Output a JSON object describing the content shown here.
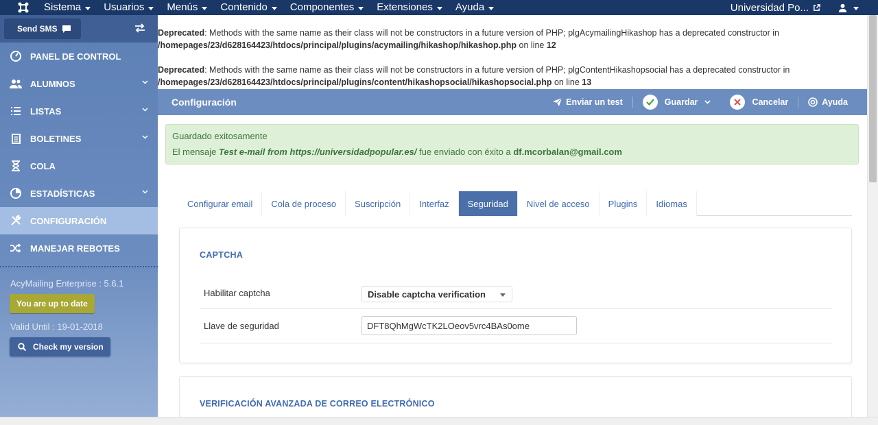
{
  "topbar": {
    "menu": [
      "Sistema",
      "Usuarios",
      "Menús",
      "Contenido",
      "Componentes",
      "Extensiones",
      "Ayuda"
    ],
    "site_name": "Universidad Po..."
  },
  "sidebar": {
    "sms_label": "Send SMS",
    "items": [
      {
        "label": "PANEL DE CONTROL",
        "icon": "dashboard-icon"
      },
      {
        "label": "ALUMNOS",
        "icon": "users-icon"
      },
      {
        "label": "LISTAS",
        "icon": "list-icon"
      },
      {
        "label": "BOLETINES",
        "icon": "newsletter-icon"
      },
      {
        "label": "COLA",
        "icon": "hourglass-icon"
      },
      {
        "label": "ESTADÍSTICAS",
        "icon": "pie-chart-icon"
      },
      {
        "label": "CONFIGURACIÓN",
        "icon": "tools-icon"
      },
      {
        "label": "MANEJAR REBOTES",
        "icon": "shuffle-icon"
      }
    ],
    "version": "AcyMailing Enterprise : 5.6.1",
    "uptodate": "You are up to date",
    "valid_until": "Valid Until : 19-01-2018",
    "check_version": "Check my version"
  },
  "deprecated": [
    {
      "label": "Deprecated",
      "text": ": Methods with the same name as their class will not be constructors in a future version of PHP; plgAcymailingHikashop has a deprecated constructor in",
      "path": "/homepages/23/d628164423/htdocs/principal/plugins/acymailing/hikashop/hikashop.php",
      "online": " on line ",
      "line": "12"
    },
    {
      "label": "Deprecated",
      "text": ": Methods with the same name as their class will not be constructors in a future version of PHP; plgContentHikashopsocial has a deprecated constructor in",
      "path": "/homepages/23/d628164423/htdocs/principal/plugins/content/hikashopsocial/hikashopsocial.php",
      "online": " on line ",
      "line": "13"
    }
  ],
  "toolbar": {
    "title": "Configuración",
    "send_test": "Enviar un test",
    "save": "Guardar",
    "cancel": "Cancelar",
    "help": "Ayuda"
  },
  "alert": {
    "title": "Guardado exitosamente",
    "msg_prefix": "El mensaje ",
    "msg_subject": "Test e-mail from https://universidadpopular.es/",
    "msg_mid": " fue enviado con éxito a ",
    "msg_email": "df.mcorbalan@gmail.com"
  },
  "tabs": [
    "Configurar email",
    "Cola de proceso",
    "Suscripción",
    "Interfaz",
    "Seguridad",
    "Nivel de acceso",
    "Plugins",
    "Idiomas"
  ],
  "captcha": {
    "heading": "CAPTCHA",
    "enable_label": "Habilitar captcha",
    "enable_value": "Disable captcha verification",
    "key_label": "Llave de seguridad",
    "key_value": "DFT8QhMgWcTK2LOeov5vrc4BAs0ome"
  },
  "advanced": {
    "heading": "VERIFICACIÓN AVANZADA DE CORREO ELECTRÓNICO"
  },
  "colors": {
    "topbar": "#1a3867",
    "sidebar": "#6c8dc0",
    "toolbar": "#6c8dc0",
    "tab_active": "#4b6fa8",
    "success_bg": "#dff0d8"
  }
}
